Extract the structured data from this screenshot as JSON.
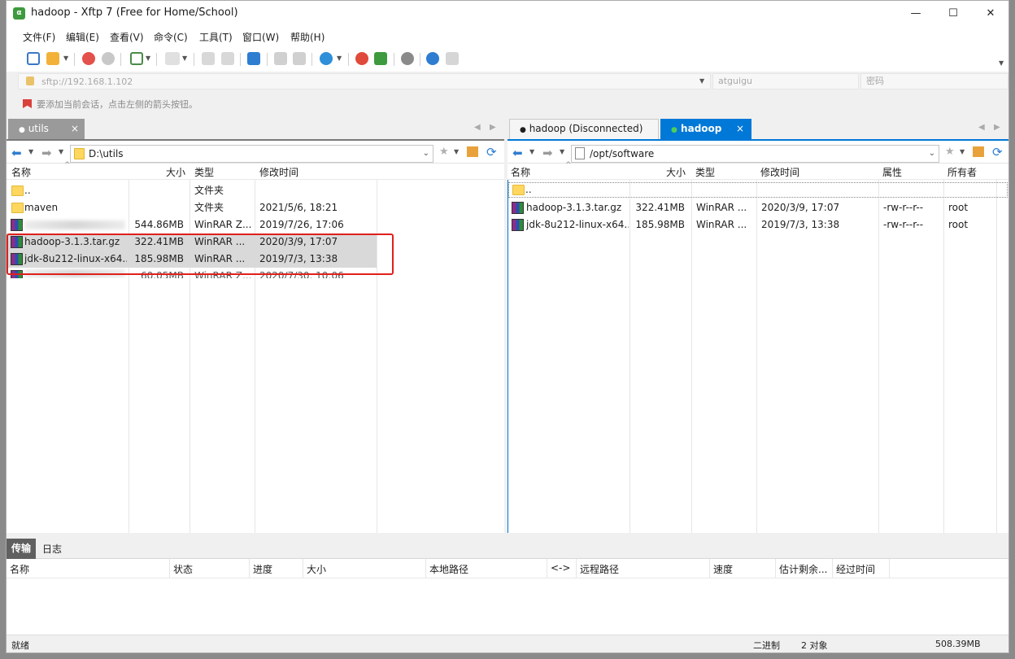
{
  "window": {
    "title": "hadoop - Xftp 7 (Free for Home/School)",
    "app_icon_text": "α",
    "controls": {
      "minimize": "—",
      "maximize": "☐",
      "close": "✕"
    }
  },
  "menu": [
    "文件(F)",
    "编辑(E)",
    "查看(V)",
    "命令(C)",
    "工具(T)",
    "窗口(W)",
    "帮助(H)"
  ],
  "address": {
    "url": "sftp://192.168.1.102",
    "username": "atguigu",
    "password_placeholder": "密码"
  },
  "hint": "要添加当前会话，点击左侧的箭头按钮。",
  "left_pane": {
    "tab": "utils",
    "tab_close": "×",
    "path": "D:\\utils",
    "columns": [
      "名称",
      "大小",
      "类型",
      "修改时间"
    ],
    "rows": [
      {
        "name": "..",
        "size": "",
        "type": "文件夹",
        "modified": "",
        "icon": "folder-icon"
      },
      {
        "name": "maven",
        "size": "",
        "type": "文件夹",
        "modified": "2021/5/6, 18:21",
        "icon": "folder-icon"
      },
      {
        "name": "",
        "size": "544.86MB",
        "type": "WinRAR Z...",
        "modified": "2019/7/26, 17:06",
        "icon": "winrar-icon"
      },
      {
        "name": "hadoop-3.1.3.tar.gz",
        "size": "322.41MB",
        "type": "WinRAR ...",
        "modified": "2020/3/9, 17:07",
        "icon": "winrar-icon"
      },
      {
        "name": "jdk-8u212-linux-x64...",
        "size": "185.98MB",
        "type": "WinRAR ...",
        "modified": "2019/7/3, 13:38",
        "icon": "winrar-icon"
      },
      {
        "name": "",
        "size": "60.05MB",
        "type": "WinRAR Z...",
        "modified": "2020/7/30, 10:06",
        "icon": "winrar-icon"
      }
    ]
  },
  "right_pane": {
    "tabs": [
      {
        "label": "hadoop (Disconnected)",
        "active": false
      },
      {
        "label": "hadoop",
        "active": true
      }
    ],
    "tab_close": "×",
    "path": "/opt/software",
    "columns": [
      "名称",
      "大小",
      "类型",
      "修改时间",
      "属性",
      "所有者"
    ],
    "rows": [
      {
        "name": "..",
        "size": "",
        "type": "",
        "modified": "",
        "attr": "",
        "owner": "",
        "icon": "folder-icon"
      },
      {
        "name": "hadoop-3.1.3.tar.gz",
        "size": "322.41MB",
        "type": "WinRAR ...",
        "modified": "2020/3/9, 17:07",
        "attr": "-rw-r--r--",
        "owner": "root",
        "icon": "winrar-icon"
      },
      {
        "name": "jdk-8u212-linux-x64...",
        "size": "185.98MB",
        "type": "WinRAR ...",
        "modified": "2019/7/3, 13:38",
        "attr": "-rw-r--r--",
        "owner": "root",
        "icon": "winrar-icon"
      }
    ]
  },
  "transfer": {
    "tabs": [
      "传输",
      "日志"
    ],
    "columns": [
      "名称",
      "状态",
      "进度",
      "大小",
      "本地路径",
      "<->",
      "远程路径",
      "速度",
      "估计剩余...",
      "经过时间"
    ]
  },
  "status": {
    "left": "就绪",
    "mode": "二进制",
    "objects": "2 对象",
    "size": "508.39MB"
  },
  "colors": {
    "accent": "#0078d7",
    "highlight_border": "#e0201c",
    "selection": "#d9d9d9"
  }
}
